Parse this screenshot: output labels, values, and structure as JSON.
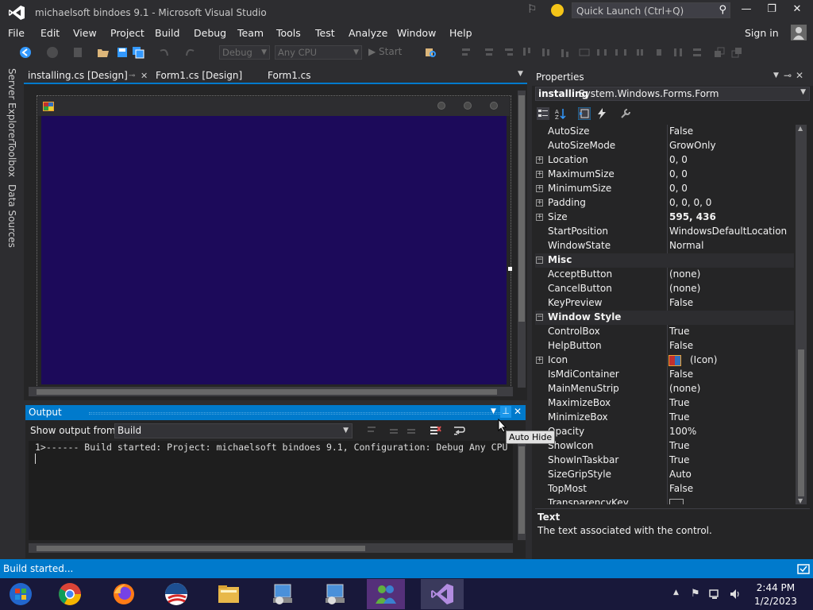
{
  "window": {
    "title": "michaelsoft bindoes 9.1 - Microsoft Visual Studio",
    "quick_launch": "Quick Launch (Ctrl+Q)",
    "minimize": "—",
    "maximize": "❐",
    "close": "✕"
  },
  "menu": [
    "File",
    "Edit",
    "View",
    "Project",
    "Build",
    "Debug",
    "Team",
    "Tools",
    "Test",
    "Analyze",
    "Window",
    "Help"
  ],
  "account": {
    "sign_in": "Sign in"
  },
  "toolbar": {
    "config": "Debug",
    "platform": "Any CPU",
    "start": "▶ Start"
  },
  "doc_tabs": [
    {
      "label": "installing.cs [Design]",
      "active": true
    },
    {
      "label": "Form1.cs [Design]",
      "active": false
    },
    {
      "label": "Form1.cs",
      "active": false
    }
  ],
  "side_tabs": [
    "Server Explorer",
    "Toolbox",
    "Data Sources"
  ],
  "output": {
    "title": "Output",
    "show_from_label": "Show output from:",
    "show_from_value": "Build",
    "line1": "1>------ Build started: Project: michaelsoft bindoes 9.1, Configuration: Debug Any CPU",
    "tooltip": "Auto Hide"
  },
  "properties": {
    "title": "Properties",
    "object_name": "installing",
    "object_type": "System.Windows.Forms.Form",
    "rows": [
      {
        "name": "AutoSize",
        "value": "False"
      },
      {
        "name": "AutoSizeMode",
        "value": "GrowOnly"
      },
      {
        "name": "Location",
        "value": "0, 0",
        "expandable": true
      },
      {
        "name": "MaximumSize",
        "value": "0, 0",
        "expandable": true
      },
      {
        "name": "MinimumSize",
        "value": "0, 0",
        "expandable": true
      },
      {
        "name": "Padding",
        "value": "0, 0, 0, 0",
        "expandable": true
      },
      {
        "name": "Size",
        "value": "595, 436",
        "expandable": true,
        "bold": true
      },
      {
        "name": "StartPosition",
        "value": "WindowsDefaultLocation"
      },
      {
        "name": "WindowState",
        "value": "Normal"
      },
      {
        "name": "Misc",
        "category": true
      },
      {
        "name": "AcceptButton",
        "value": "(none)"
      },
      {
        "name": "CancelButton",
        "value": "(none)"
      },
      {
        "name": "KeyPreview",
        "value": "False"
      },
      {
        "name": "Window Style",
        "category": true
      },
      {
        "name": "ControlBox",
        "value": "True"
      },
      {
        "name": "HelpButton",
        "value": "False"
      },
      {
        "name": "Icon",
        "value": "(Icon)",
        "expandable": true,
        "icon": true
      },
      {
        "name": "IsMdiContainer",
        "value": "False"
      },
      {
        "name": "MainMenuStrip",
        "value": "(none)"
      },
      {
        "name": "MaximizeBox",
        "value": "True"
      },
      {
        "name": "MinimizeBox",
        "value": "True"
      },
      {
        "name": "Opacity",
        "value": "100%"
      },
      {
        "name": "ShowIcon",
        "value": "True"
      },
      {
        "name": "ShowInTaskbar",
        "value": "True"
      },
      {
        "name": "SizeGripStyle",
        "value": "Auto"
      },
      {
        "name": "TopMost",
        "value": "False"
      },
      {
        "name": "TransparencyKey",
        "value": "",
        "swatch": true
      }
    ],
    "desc_title": "Text",
    "desc_text": "The text associated with the control."
  },
  "status": {
    "text": "Build started..."
  },
  "taskbar": {
    "time": "2:44 PM",
    "date": "1/2/2023"
  },
  "colors": {
    "accent": "#007acc",
    "form_back": "#1c0a5a",
    "taskbar": "#18183a"
  }
}
